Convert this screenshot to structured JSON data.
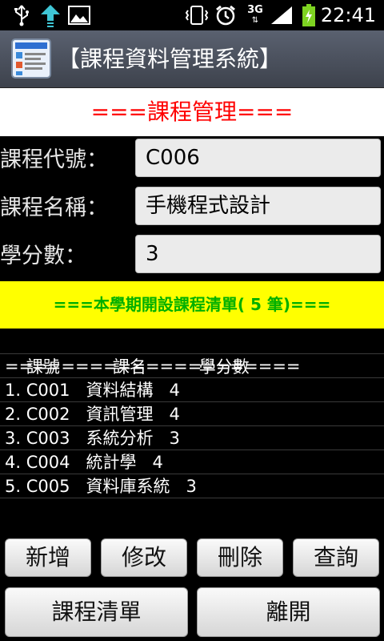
{
  "status_bar": {
    "time": "22:41",
    "network": "3G",
    "icons": [
      "usb-icon",
      "upload-icon",
      "image-icon",
      "vibrate-icon",
      "alarm-icon",
      "3g-icon",
      "signal-icon",
      "battery-charging-icon"
    ]
  },
  "app": {
    "title": "【課程資料管理系統】"
  },
  "form": {
    "heading": "===課程管理===",
    "fields": [
      {
        "label": "課程代號：",
        "value": "C006"
      },
      {
        "label": "課程名稱：",
        "value": "手機程式設計"
      },
      {
        "label": "學分數：",
        "value": "3"
      }
    ]
  },
  "list": {
    "heading": "===本學期開設課程清單( 5 筆)===",
    "columns": {
      "code": "課號",
      "name": "課名",
      "credits": "學分數"
    },
    "separator": "=====================",
    "rows": [
      "1. C001   資料結構   4",
      "2. C002   資訊管理   4",
      "3. C003   系統分析   3",
      "4. C004   統計學   4",
      "5. C005   資料庫系統   3"
    ]
  },
  "buttons": {
    "add": "新增",
    "edit": "修改",
    "delete": "刪除",
    "query": "查詢",
    "course_list": "課程清單",
    "exit": "離開"
  },
  "colors": {
    "heading_red": "#ff0000",
    "list_banner_bg": "#ffff00",
    "list_banner_text": "#00b000",
    "battery": "#7ed321"
  }
}
